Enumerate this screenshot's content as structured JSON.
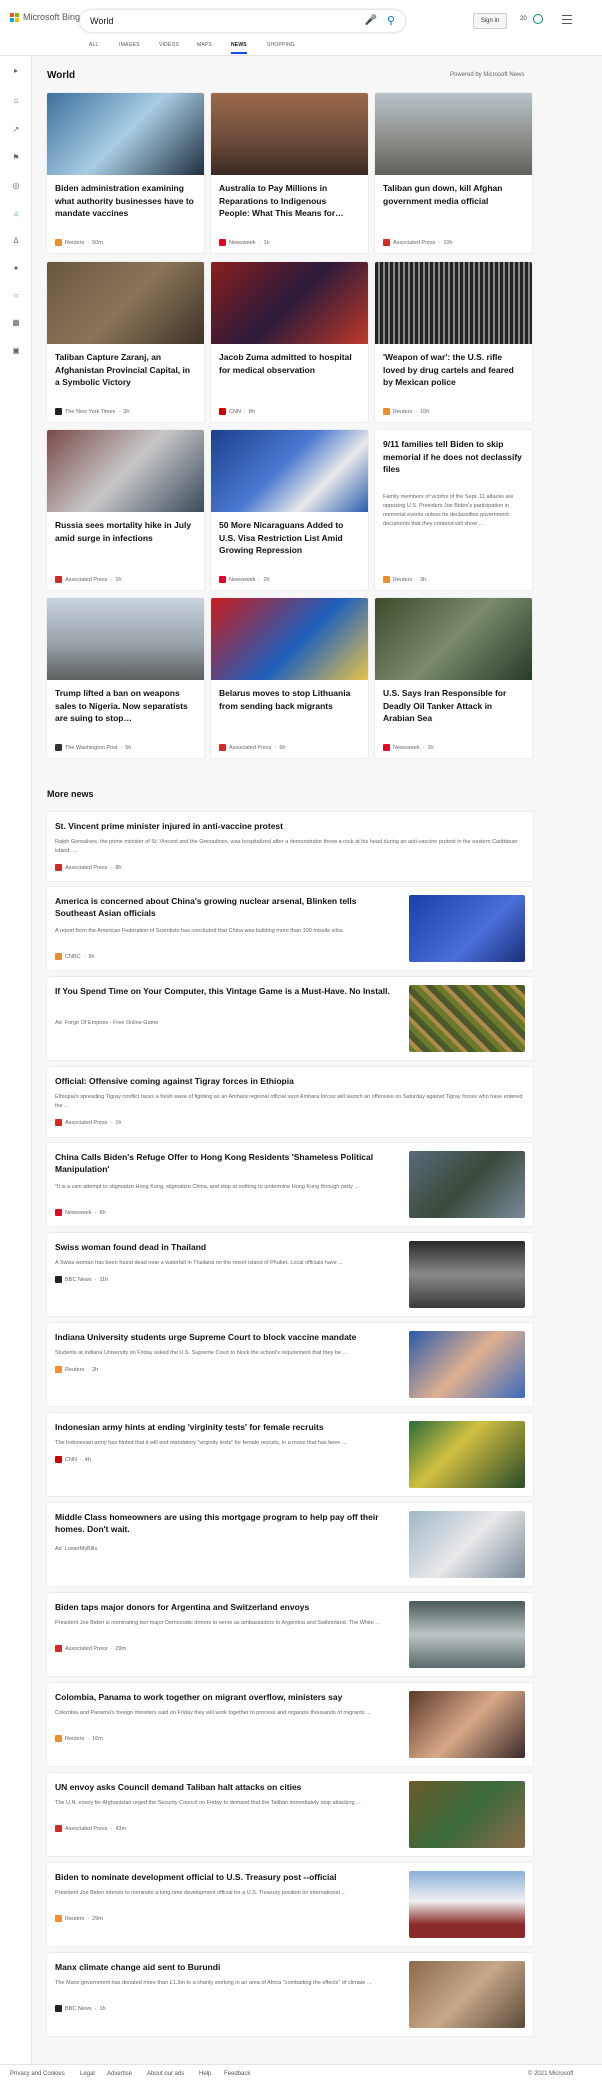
{
  "header": {
    "logo_text": "Microsoft Bing",
    "search_value": "World",
    "signin_label": "Sign in",
    "points": "20",
    "tabs": [
      "ALL",
      "IMAGES",
      "VIDEOS",
      "MAPS",
      "NEWS",
      "SHOPPING"
    ],
    "active_tab": "NEWS"
  },
  "section": {
    "title": "World",
    "powered_by": "Powered by Microsoft News"
  },
  "top_cards": [
    {
      "title": "Biden administration examining what authority businesses have to mandate vaccines",
      "source": "Reuters",
      "time": "50m",
      "source_color": "#f28c28"
    },
    {
      "title": "Australia to Pay Millions in Reparations to Indigenous People: What This Means for…",
      "source": "Newsweek",
      "time": "1h",
      "source_color": "#e4002b"
    },
    {
      "title": "Taliban gun down, kill Afghan government media official",
      "source": "Associated Press",
      "time": "10h",
      "source_color": "#d62828"
    },
    {
      "title": "Taliban Capture Zaranj, an Afghanistan Provincial Capital, in a Symbolic Victory",
      "source": "The New York Times",
      "time": "3h",
      "source_color": "#222222"
    },
    {
      "title": "Jacob Zuma admitted to hospital for medical observation",
      "source": "CNN",
      "time": "8h",
      "source_color": "#cc0000"
    },
    {
      "title": "'Weapon of war': the U.S. rifle loved by drug cartels and feared by Mexican police",
      "source": "Reuters",
      "time": "10h",
      "source_color": "#f28c28"
    },
    {
      "title": "Russia sees mortality hike in July amid surge in infections",
      "source": "Associated Press",
      "time": "1h",
      "source_color": "#d62828"
    },
    {
      "title": "50 More Nicaraguans Added to U.S. Visa Restriction List Amid Growing Repression",
      "source": "Newsweek",
      "time": "2h",
      "source_color": "#e4002b"
    },
    {
      "title": "9/11 families tell Biden to skip memorial if he does not declassify files",
      "desc": "Family members of victims of the Sept. 11 attacks are opposing U.S. President Joe Biden's participation in memorial events unless he declassifies government documents that they contend will show ...",
      "source": "Reuters",
      "time": "3h",
      "source_color": "#f28c28"
    },
    {
      "title": "Trump lifted a ban on weapons sales to Nigeria. Now separatists are suing to stop…",
      "source": "The Washington Post",
      "time": "5h",
      "source_color": "#333333"
    },
    {
      "title": "Belarus moves to stop Lithuania from sending back migrants",
      "source": "Associated Press",
      "time": "6h",
      "source_color": "#d62828"
    },
    {
      "title": "U.S. Says Iran Responsible for Deadly Oil Tanker Attack in Arabian Sea",
      "source": "Newsweek",
      "time": "2h",
      "source_color": "#e4002b"
    }
  ],
  "more_news": {
    "title": "More news",
    "items": [
      {
        "title": "St. Vincent prime minister injured in anti-vaccine protest",
        "desc": "Ralph Gonsalves, the prime minister of St. Vincent and the Grenadines, was hospitalized after a demonstrator threw a rock at his head during an anti-vaccine protest in the eastern Caribbean island, ...",
        "source": "Associated Press",
        "time": "8h",
        "source_color": "#d62828"
      },
      {
        "title": "America is concerned about China's growing nuclear arsenal, Blinken tells Southeast Asian officials",
        "desc": "A report from the American Federation of Scientists has concluded that China was building more than 100 missile silos.",
        "source": "CNBC",
        "time": "3h",
        "source_color": "#f28c28"
      },
      {
        "title": "If You Spend Time on Your Computer, this Vintage Game is a Must-Have. No Install.",
        "desc": "",
        "source": "Forge Of Empires - Free Online Game",
        "time": "",
        "ad": "Ad",
        "source_color": ""
      },
      {
        "title": "Official: Offensive coming against Tigray forces in Ethiopia",
        "desc": "Ethiopia's spreading Tigray conflict faces a fresh wave of fighting as an Amhara regional official says Amhara forces will launch an offensive on Saturday against Tigray forces who have entered the ...",
        "source": "Associated Press",
        "time": "1h",
        "source_color": "#d62828"
      },
      {
        "title": "China Calls Biden's Refuge Offer to Hong Kong Residents 'Shameless Political Manipulation'",
        "desc": "\"It is a vain attempt to stigmatize Hong Kong, stigmatize China, and stop at nothing to undermine Hong Kong through petty ...",
        "source": "Newsweek",
        "time": "6h",
        "source_color": "#e4002b"
      },
      {
        "title": "Swiss woman found dead in Thailand",
        "desc": "A Swiss woman has been found dead near a waterfall in Thailand on the resort island of Phuket. Local officials have ...",
        "source": "BBC News",
        "time": "11h",
        "source_color": "#222222"
      },
      {
        "title": "Indiana University students urge Supreme Court to block vaccine mandate",
        "desc": "Students at Indiana University on Friday asked the U.S. Supreme Court to block the school's requirement that they be ...",
        "source": "Reuters",
        "time": "2h",
        "source_color": "#f28c28"
      },
      {
        "title": "Indonesian army hints at ending 'virginity tests' for female recruits",
        "desc": "The Indonesian army has hinted that it will end mandatory \"virginity tests\" for female recruits, in a move that has been ...",
        "source": "CNN",
        "time": "4h",
        "source_color": "#cc0000"
      },
      {
        "title": "Middle Class homeowners are using this mortgage program to help pay off their homes. Don't wait.",
        "desc": "",
        "source": "LowerMyBills",
        "time": "",
        "ad": "Ad",
        "source_color": ""
      },
      {
        "title": "Biden taps major donors for Argentina and Switzerland envoys",
        "desc": "President Joe Biden is nominating two major Democratic donors to serve as ambassadors to Argentina and Switzerland. The White ...",
        "source": "Associated Press",
        "time": "29m",
        "source_color": "#d62828"
      },
      {
        "title": "Colombia, Panama to work together on migrant overflow, ministers say",
        "desc": "Colombia and Panama's foreign ministers said on Friday they will work together to process and organize thousands of migrants ...",
        "source": "Reuters",
        "time": "16m",
        "source_color": "#f28c28"
      },
      {
        "title": "UN envoy asks Council demand Taliban halt attacks on cities",
        "desc": "The U.N. envoy for Afghanistan urged the Security Council on Friday to demand that the Taliban immediately stop attacking ...",
        "source": "Associated Press",
        "time": "43m",
        "source_color": "#d62828"
      },
      {
        "title": "Biden to nominate development official to U.S. Treasury post --official",
        "desc": "President Joe Biden intends to nominate a long-time development official for a U.S. Treasury position on international ...",
        "source": "Reuters",
        "time": "29m",
        "source_color": "#f28c28"
      },
      {
        "title": "Manx climate change aid sent to Burundi",
        "desc": "The Manx government has donated more than £1.3m to a charity working in an area of Africa \"combatting the effects\" of climate ...",
        "source": "BBC News",
        "time": "1h",
        "source_color": "#222222"
      }
    ]
  },
  "footer": {
    "links": [
      "Privacy and Cookies",
      "Legal",
      "Advertise",
      "About our ads",
      "Help",
      "Feedback"
    ],
    "copyright": "© 2021 Microsoft"
  }
}
